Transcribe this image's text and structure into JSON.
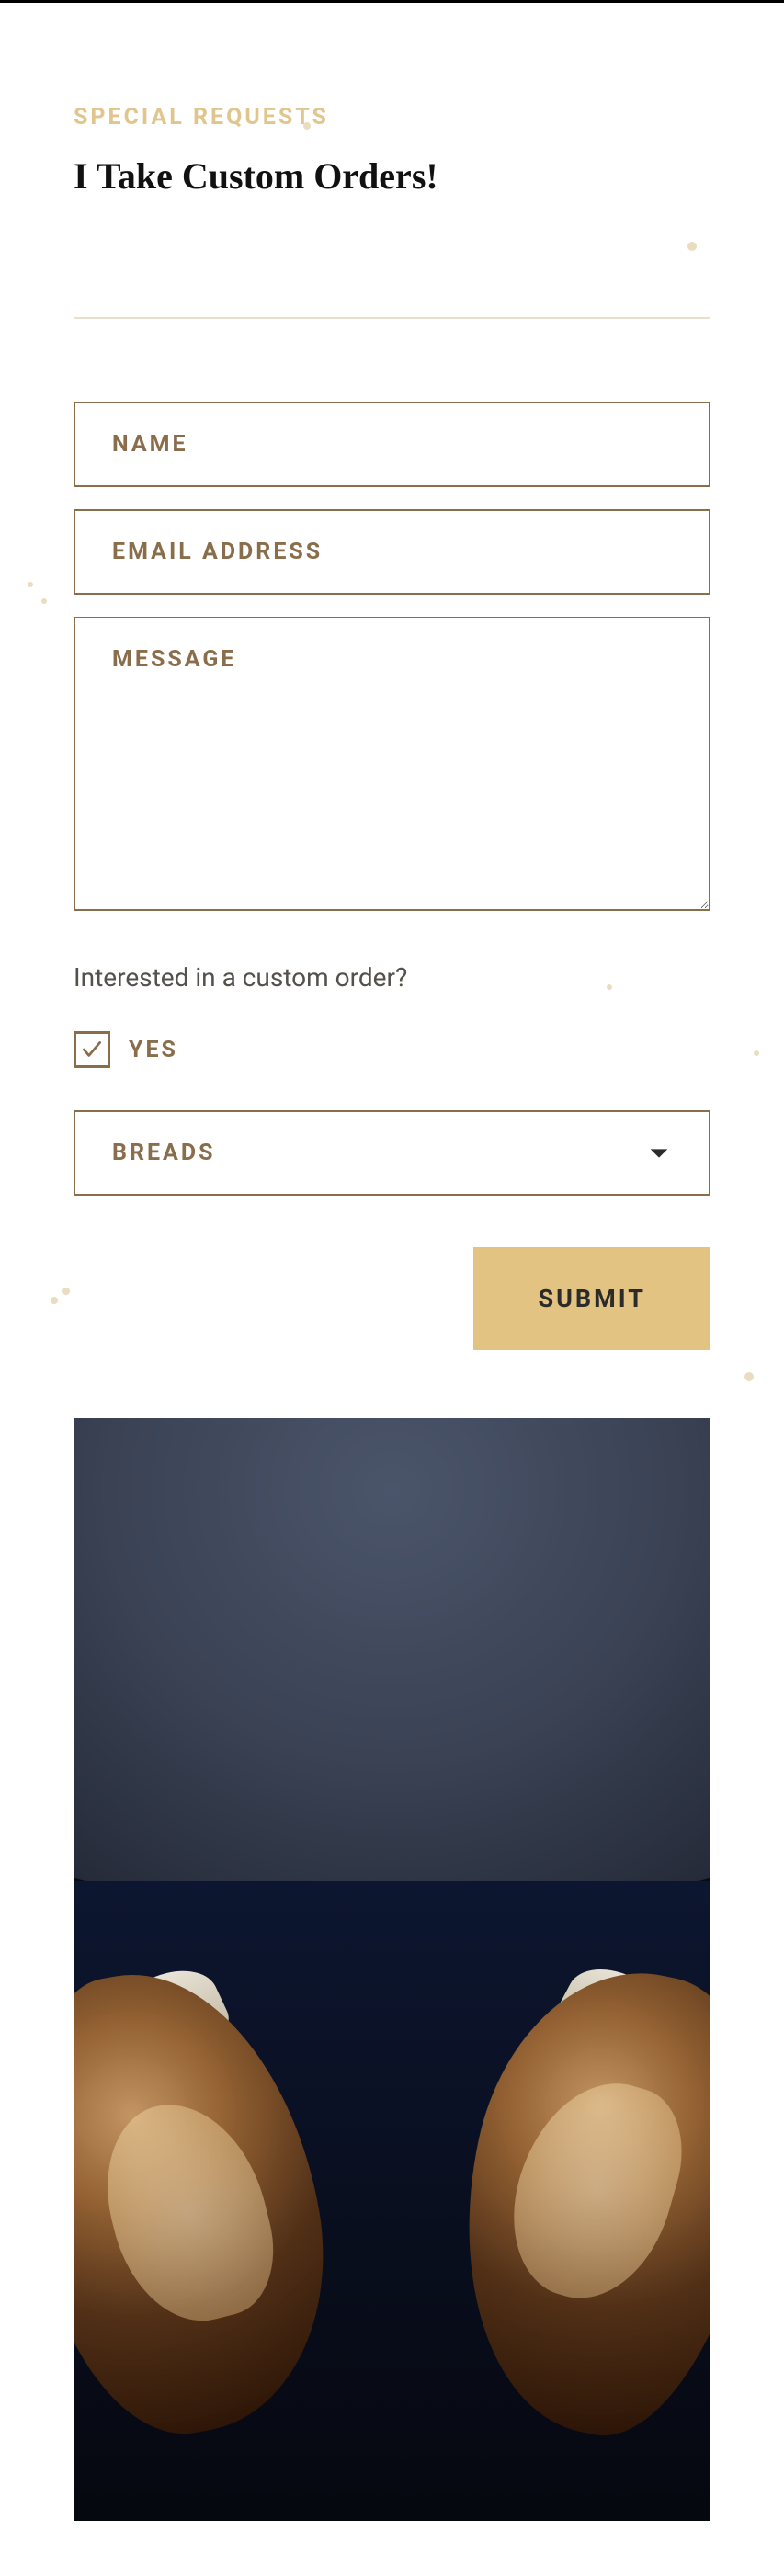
{
  "header": {
    "eyebrow": "SPECIAL REQUESTS",
    "title": "I Take Custom Orders!"
  },
  "form": {
    "name_placeholder": "Name",
    "email_placeholder": "Email Address",
    "message_placeholder": "Message",
    "question": "Interested in a custom order?",
    "checkbox_label": "Yes",
    "checkbox_checked": true,
    "select_value": "Breads",
    "submit_label": "Submit"
  }
}
